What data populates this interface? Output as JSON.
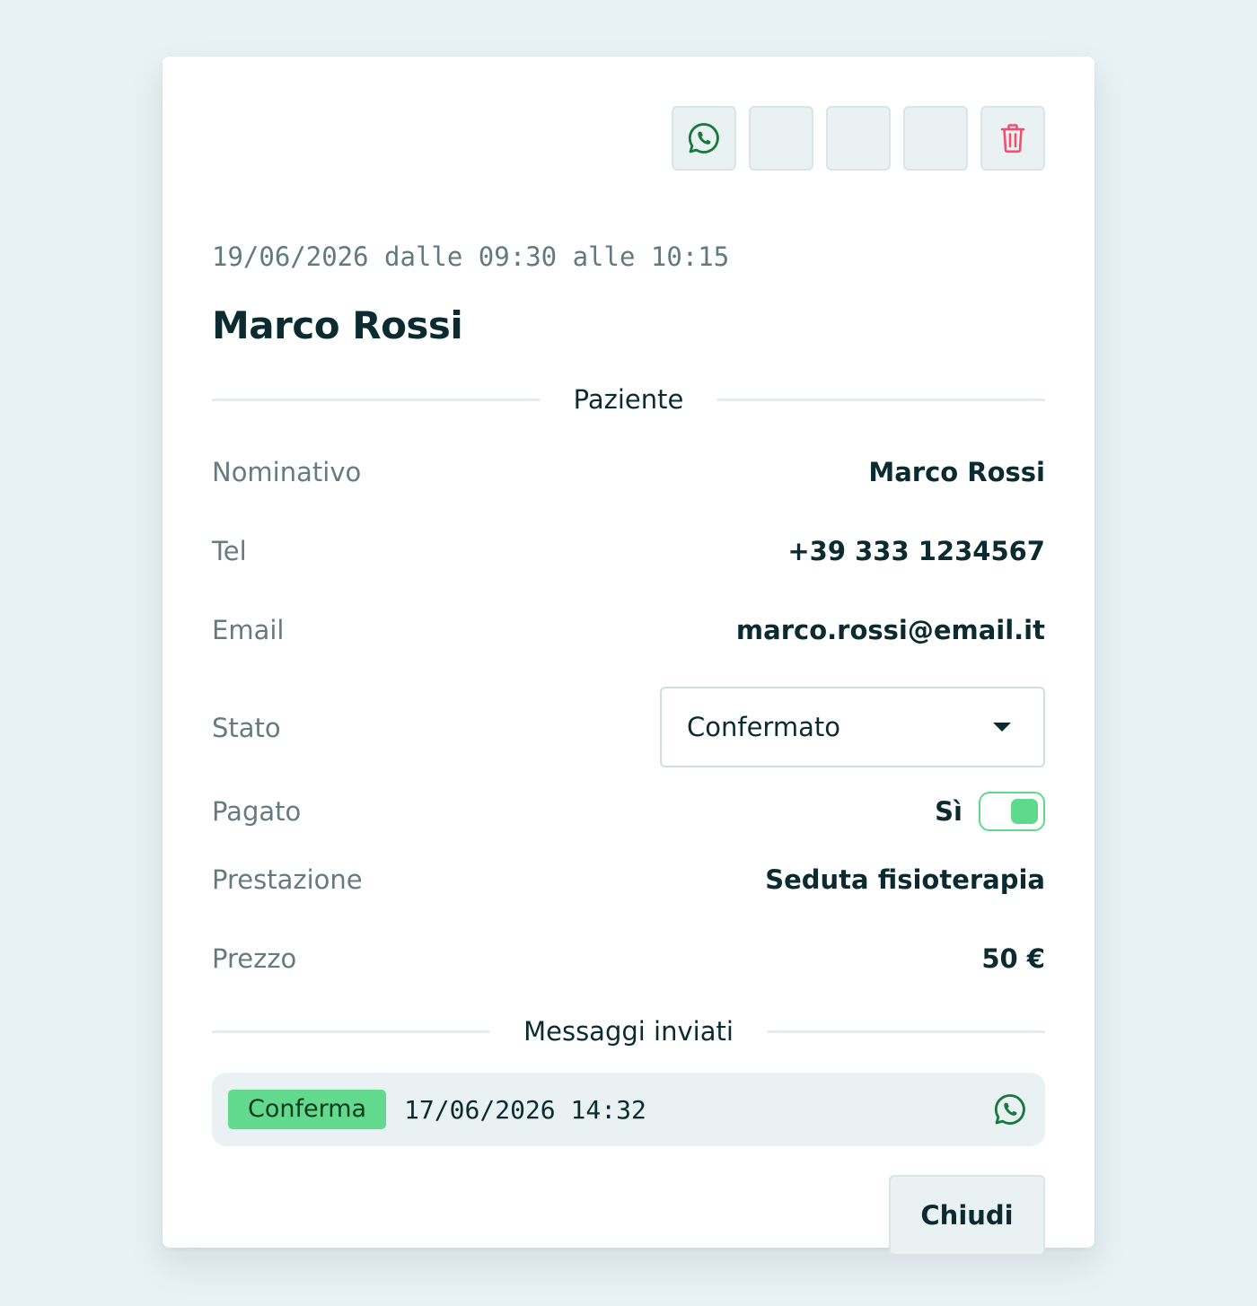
{
  "appointment": {
    "datetime": "19/06/2026 dalle 09:30 alle 10:15",
    "title": "Marco Rossi"
  },
  "toolbar": {
    "whatsapp_icon": "whatsapp-icon",
    "delete_icon": "trash-icon",
    "delete_color": "#f0506e"
  },
  "patient_section": {
    "heading": "Paziente",
    "fields": {
      "name": {
        "label": "Nominativo",
        "value": "Marco Rossi"
      },
      "phone": {
        "label": "Tel",
        "value": "+39 333 1234567"
      },
      "email": {
        "label": "Email",
        "value": "marco.rossi@email.it"
      },
      "status": {
        "label": "Stato",
        "value": "Confermato"
      },
      "paid": {
        "label": "Pagato",
        "value": "Sì",
        "checked": true
      },
      "service": {
        "label": "Prestazione",
        "value": "Seduta fisioterapia"
      },
      "price": {
        "label": "Prezzo",
        "value": "50 €"
      }
    }
  },
  "messages_section": {
    "heading": "Messaggi inviati",
    "items": [
      {
        "type": "Conferma",
        "datetime": "17/06/2026 14:32",
        "channel_icon": "whatsapp-icon"
      }
    ]
  },
  "footer": {
    "close_label": "Chiudi"
  },
  "colors": {
    "whatsapp_green": "#157a3c",
    "paid_green": "#5fd98b",
    "background": "#e8f1f3"
  }
}
